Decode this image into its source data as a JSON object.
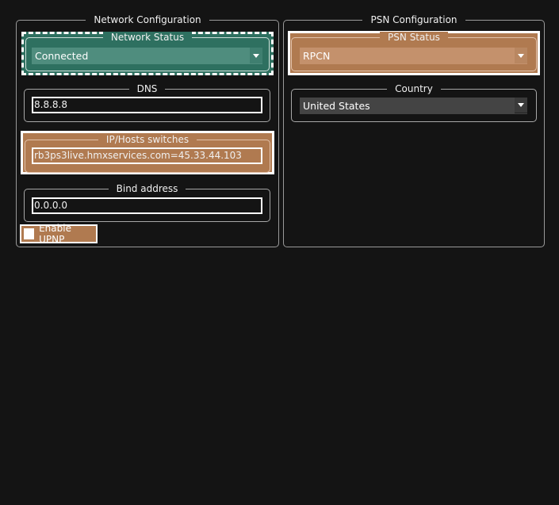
{
  "network": {
    "title": "Network Configuration",
    "status": {
      "label": "Network Status",
      "value": "Connected"
    },
    "dns": {
      "label": "DNS",
      "value": "8.8.8.8"
    },
    "ip_hosts": {
      "label": "IP/Hosts switches",
      "value": "rb3ps3live.hmxservices.com=45.33.44.103"
    },
    "bind": {
      "label": "Bind address",
      "value": "0.0.0.0"
    },
    "upnp": {
      "label": "Enable UPNP",
      "checked": false
    }
  },
  "psn": {
    "title": "PSN Configuration",
    "status": {
      "label": "PSN Status",
      "value": "RPCN"
    },
    "country": {
      "label": "Country",
      "value": "United States"
    }
  },
  "colors": {
    "background": "#141414",
    "highlight_green": "#2e7060",
    "highlight_brown": "#b07a50"
  }
}
